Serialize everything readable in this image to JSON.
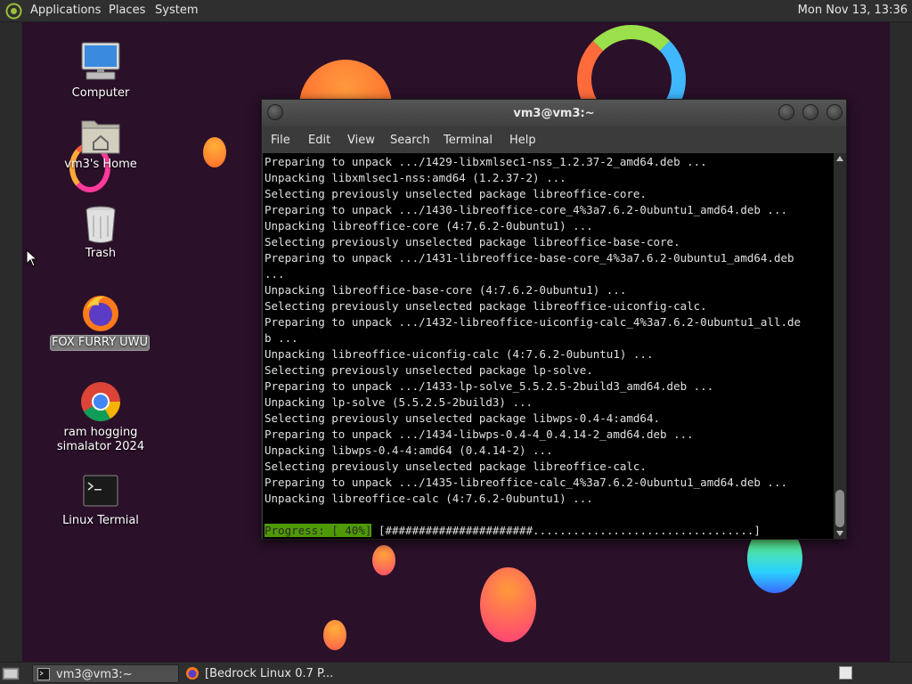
{
  "top_panel": {
    "menus": [
      "Applications",
      "Places",
      "System"
    ],
    "clock": "Mon Nov 13, 13:36"
  },
  "desktop_icons": [
    {
      "label": "Computer",
      "icon": "computer-icon"
    },
    {
      "label": "vm3's Home",
      "icon": "home-folder-icon"
    },
    {
      "label": "Trash",
      "icon": "trash-icon"
    },
    {
      "label": "FOX FURRY UWU",
      "icon": "firefox-icon",
      "selected": true
    },
    {
      "label": "ram hogging simalator 2024",
      "icon": "chrome-icon"
    },
    {
      "label": "Linux Termial",
      "icon": "terminal-icon"
    }
  ],
  "terminal": {
    "title": "vm3@vm3:~",
    "menu": [
      "File",
      "Edit",
      "View",
      "Search",
      "Terminal",
      "Help"
    ],
    "lines": [
      "Preparing to unpack .../1429-libxmlsec1-nss_1.2.37-2_amd64.deb ...",
      "Unpacking libxmlsec1-nss:amd64 (1.2.37-2) ...",
      "Selecting previously unselected package libreoffice-core.",
      "Preparing to unpack .../1430-libreoffice-core_4%3a7.6.2-0ubuntu1_amd64.deb ...",
      "Unpacking libreoffice-core (4:7.6.2-0ubuntu1) ...",
      "Selecting previously unselected package libreoffice-base-core.",
      "Preparing to unpack .../1431-libreoffice-base-core_4%3a7.6.2-0ubuntu1_amd64.deb",
      "...",
      "Unpacking libreoffice-base-core (4:7.6.2-0ubuntu1) ...",
      "Selecting previously unselected package libreoffice-uiconfig-calc.",
      "Preparing to unpack .../1432-libreoffice-uiconfig-calc_4%3a7.6.2-0ubuntu1_all.de",
      "b ...",
      "Unpacking libreoffice-uiconfig-calc (4:7.6.2-0ubuntu1) ...",
      "Selecting previously unselected package lp-solve.",
      "Preparing to unpack .../1433-lp-solve_5.5.2.5-2build3_amd64.deb ...",
      "Unpacking lp-solve (5.5.2.5-2build3) ...",
      "Selecting previously unselected package libwps-0.4-4:amd64.",
      "Preparing to unpack .../1434-libwps-0.4-4_0.4.14-2_amd64.deb ...",
      "Unpacking libwps-0.4-4:amd64 (0.4.14-2) ...",
      "Selecting previously unselected package libreoffice-calc.",
      "Preparing to unpack .../1435-libreoffice-calc_4%3a7.6.2-0ubuntu1_amd64.deb ...",
      "Unpacking libreoffice-calc (4:7.6.2-0ubuntu1) ..."
    ],
    "progress_label": "Progress: [ 40%]",
    "progress_bar": "[######################.................................]",
    "progress_percent": 40
  },
  "taskbar": {
    "tasks": [
      {
        "label": "vm3@vm3:~",
        "icon": "terminal-icon",
        "active": true
      },
      {
        "label": "[Bedrock Linux 0.7 P...",
        "icon": "firefox-icon",
        "active": false
      }
    ]
  },
  "colors": {
    "wallpaper": "#2a1029",
    "panel": "#2f2f2f",
    "progress_green": "#4e9a06"
  }
}
